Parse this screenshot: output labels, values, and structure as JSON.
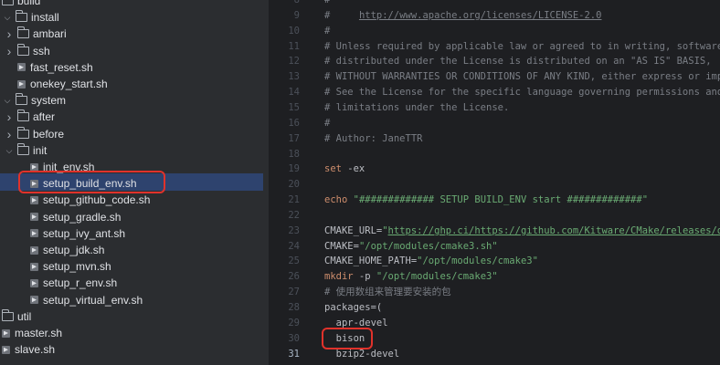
{
  "project_tree": {
    "items": [
      {
        "label": "build",
        "type": "folder",
        "chev": "",
        "indent": 0
      },
      {
        "label": "install",
        "type": "folder",
        "chev": "down",
        "indent": 0
      },
      {
        "label": "ambari",
        "type": "folder",
        "chev": "right",
        "indent": 1
      },
      {
        "label": "ssh",
        "type": "folder",
        "chev": "right",
        "indent": 1
      },
      {
        "label": "fast_reset.sh",
        "type": "file",
        "chev": "",
        "indent": 1
      },
      {
        "label": "onekey_start.sh",
        "type": "file",
        "chev": "",
        "indent": 1
      },
      {
        "label": "system",
        "type": "folder",
        "chev": "down",
        "indent": 0
      },
      {
        "label": "after",
        "type": "folder",
        "chev": "right",
        "indent": 1
      },
      {
        "label": "before",
        "type": "folder",
        "chev": "right",
        "indent": 1
      },
      {
        "label": "init",
        "type": "folder",
        "chev": "down",
        "indent": 1
      },
      {
        "label": "init_env.sh",
        "type": "file",
        "chev": "",
        "indent": 2
      },
      {
        "label": "setup_build_env.sh",
        "type": "file",
        "chev": "",
        "indent": 2,
        "selected": true
      },
      {
        "label": "setup_github_code.sh",
        "type": "file",
        "chev": "",
        "indent": 2
      },
      {
        "label": "setup_gradle.sh",
        "type": "file",
        "chev": "",
        "indent": 2
      },
      {
        "label": "setup_ivy_ant.sh",
        "type": "file",
        "chev": "",
        "indent": 2
      },
      {
        "label": "setup_jdk.sh",
        "type": "file",
        "chev": "",
        "indent": 2
      },
      {
        "label": "setup_mvn.sh",
        "type": "file",
        "chev": "",
        "indent": 2
      },
      {
        "label": "setup_r_env.sh",
        "type": "file",
        "chev": "",
        "indent": 2
      },
      {
        "label": "setup_virtual_env.sh",
        "type": "file",
        "chev": "",
        "indent": 2
      },
      {
        "label": "util",
        "type": "folder",
        "chev": "",
        "indent": 0
      },
      {
        "label": "master.sh",
        "type": "file",
        "chev": "",
        "indent": 0
      },
      {
        "label": "slave.sh",
        "type": "file",
        "chev": "",
        "indent": 0
      }
    ]
  },
  "editor": {
    "current_line": "31",
    "lines": [
      {
        "n": "8",
        "parts": [
          [
            "c",
            "#"
          ]
        ]
      },
      {
        "n": "9",
        "parts": [
          [
            "c",
            "#     "
          ],
          [
            "l",
            "http://www.apache.org/licenses/LICENSE-2.0"
          ]
        ]
      },
      {
        "n": "10",
        "parts": [
          [
            "c",
            "#"
          ]
        ]
      },
      {
        "n": "11",
        "parts": [
          [
            "c",
            "# Unless required by applicable law or agreed to in writing, software"
          ]
        ]
      },
      {
        "n": "12",
        "parts": [
          [
            "c",
            "# distributed under the License is distributed on an \"AS IS\" BASIS,"
          ]
        ]
      },
      {
        "n": "13",
        "parts": [
          [
            "c",
            "# WITHOUT WARRANTIES OR CONDITIONS OF ANY KIND, either express or impli"
          ]
        ]
      },
      {
        "n": "14",
        "parts": [
          [
            "c",
            "# See the License for the specific language governing permissions and"
          ]
        ]
      },
      {
        "n": "15",
        "parts": [
          [
            "c",
            "# limitations under the License."
          ]
        ]
      },
      {
        "n": "16",
        "parts": [
          [
            "c",
            "#"
          ]
        ]
      },
      {
        "n": "17",
        "parts": [
          [
            "c",
            "# Author: JaneTTR"
          ]
        ]
      },
      {
        "n": "18",
        "parts": []
      },
      {
        "n": "19",
        "parts": [
          [
            "k",
            "set"
          ],
          [
            "p",
            " -ex"
          ]
        ]
      },
      {
        "n": "20",
        "parts": []
      },
      {
        "n": "21",
        "parts": [
          [
            "k",
            "echo"
          ],
          [
            "p",
            " "
          ],
          [
            "s",
            "\"############# SETUP BUILD_ENV start #############\""
          ]
        ]
      },
      {
        "n": "22",
        "parts": []
      },
      {
        "n": "23",
        "parts": [
          [
            "p",
            "CMAKE_URL="
          ],
          [
            "s",
            "\""
          ],
          [
            "sl",
            "https://ghp.ci/https://github.com/Kitware/CMake/releases/dow"
          ]
        ]
      },
      {
        "n": "24",
        "parts": [
          [
            "p",
            "CMAKE="
          ],
          [
            "s",
            "\"/opt/modules/cmake3.sh\""
          ]
        ]
      },
      {
        "n": "25",
        "parts": [
          [
            "p",
            "CMAKE_HOME_PATH="
          ],
          [
            "s",
            "\"/opt/modules/cmake3\""
          ]
        ]
      },
      {
        "n": "26",
        "parts": [
          [
            "k",
            "mkdir"
          ],
          [
            "p",
            " -p "
          ],
          [
            "s",
            "\"/opt/modules/cmake3\""
          ]
        ]
      },
      {
        "n": "27",
        "parts": [
          [
            "c",
            "# 使用数组来管理要安装的包"
          ]
        ]
      },
      {
        "n": "28",
        "parts": [
          [
            "p",
            "packages=("
          ]
        ]
      },
      {
        "n": "29",
        "parts": [
          [
            "p",
            "  apr-devel"
          ]
        ]
      },
      {
        "n": "30",
        "parts": [
          [
            "p",
            "  bison"
          ]
        ]
      },
      {
        "n": "31",
        "parts": [
          [
            "p",
            "  bzip2-devel"
          ]
        ]
      }
    ]
  }
}
